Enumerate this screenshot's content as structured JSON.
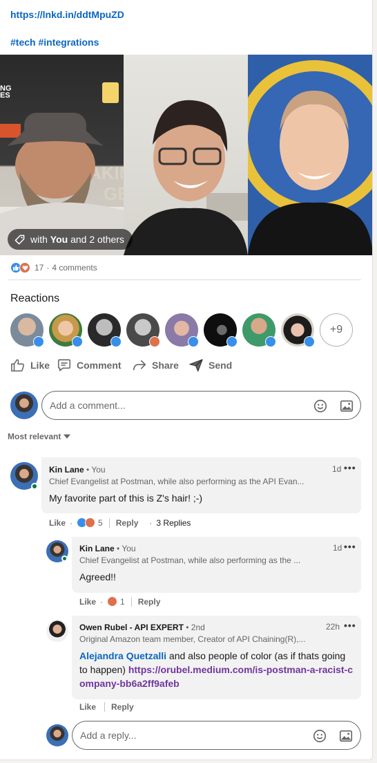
{
  "post": {
    "link": "https://lnkd.in/ddtMpuZD",
    "hashtags": "#tech #integrations",
    "video_tag": {
      "prefix": "with ",
      "you": "You",
      "suffix": " and 2 others"
    },
    "reaction_count": "17",
    "comments_count": "4 comments",
    "dot": "·"
  },
  "reactions": {
    "title": "Reactions",
    "more": "+9"
  },
  "actions": {
    "like": "Like",
    "comment": "Comment",
    "share": "Share",
    "send": "Send"
  },
  "comment_box": {
    "placeholder": "Add a comment..."
  },
  "sort": {
    "label": "Most relevant"
  },
  "comments": [
    {
      "name": "Kin Lane",
      "meta": " • You",
      "headline": "Chief Evangelist at Postman, while also performing as the API Evan...",
      "time": "1d",
      "text": "My favorite part of this is Z's hair! ;-)",
      "like": "Like",
      "dot": "·",
      "reaction_count": "5",
      "reply": "Reply",
      "replies": "3 Replies"
    },
    {
      "name": "Kin Lane",
      "meta": " • You",
      "headline": "Chief Evangelist at Postman, while also performing as the ...",
      "time": "1d",
      "text": "Agreed!!",
      "like": "Like",
      "dot": "·",
      "reaction_count": "1",
      "reply": "Reply"
    },
    {
      "name": "Owen Rubel - API EXPERT",
      "meta": " • 2nd",
      "headline": "Original Amazon team member, Creator of API Chaining(R),...",
      "time": "22h",
      "mention": "Alejandra Quetzalli",
      "text_mid": " and also people of color (as if thats going to happen) ",
      "link": "https://orubel.medium.com/is-postman-a-racist-company-bb6a2ff9afeb",
      "like": "Like",
      "reply": "Reply"
    }
  ],
  "reply_box": {
    "placeholder": "Add a reply..."
  },
  "menu_dots": "•••",
  "colors": {
    "linkedin_blue": "#0a66c2",
    "like_blue": "#378fe9",
    "love_red": "#df704d",
    "visited_purple": "#70369c",
    "bubble_gray": "#f2f2f2"
  }
}
